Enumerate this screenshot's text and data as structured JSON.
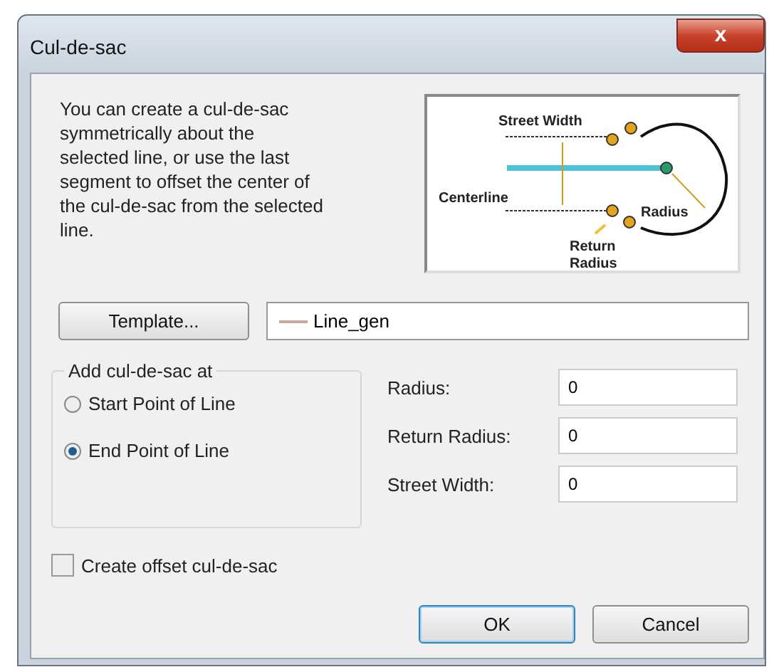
{
  "window": {
    "title": "Cul-de-sac",
    "close_glyph": "x"
  },
  "description": "You can create a cul-de-sac symmetrically about the selected line, or use the last segment to offset the center of the cul-de-sac from the selected line.",
  "diagram": {
    "labels": [
      {
        "kind": "street_width",
        "text": "Street Width"
      },
      {
        "kind": "centerline",
        "text": "Centerline"
      },
      {
        "kind": "radius",
        "text": "Radius"
      },
      {
        "kind": "return_radius",
        "text": "Return Radius"
      }
    ]
  },
  "template": {
    "button": "Template...",
    "value": "Line_gen"
  },
  "group": {
    "title": "Add cul-de-sac at",
    "options": [
      {
        "label": "Start Point of Line",
        "selected": false
      },
      {
        "label": "End Point of Line",
        "selected": true
      }
    ]
  },
  "fields": [
    {
      "label": "Radius:",
      "value": "0"
    },
    {
      "label": "Return Radius:",
      "value": "0"
    },
    {
      "label": "Street Width:",
      "value": "0"
    }
  ],
  "offset": {
    "label": "Create offset cul-de-sac",
    "checked": false
  },
  "buttons": [
    {
      "label": "OK",
      "default": true
    },
    {
      "label": "Cancel",
      "default": false
    }
  ]
}
